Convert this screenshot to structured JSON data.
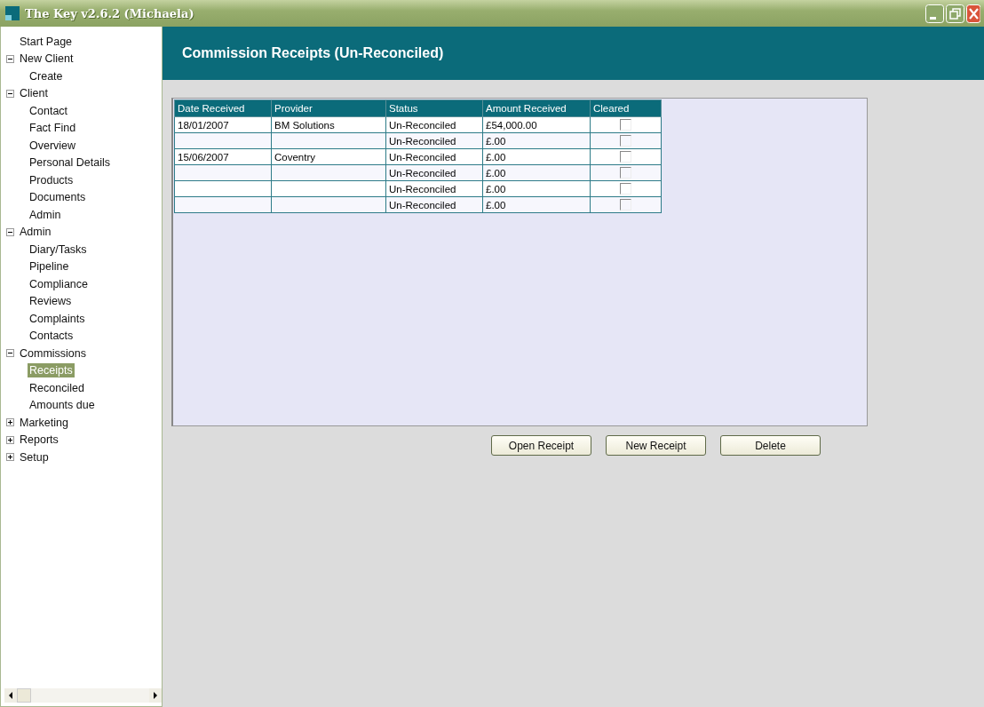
{
  "window": {
    "title": "The Key v2.6.2 (Michaela)"
  },
  "sidebar": {
    "items": [
      {
        "label": "Start Page",
        "selected": false
      },
      {
        "label": "New Client",
        "selected": false,
        "expanded": true,
        "children": [
          {
            "label": "Create",
            "selected": false
          }
        ]
      },
      {
        "label": "Client",
        "selected": false,
        "expanded": true,
        "children": [
          {
            "label": "Contact",
            "selected": false
          },
          {
            "label": "Fact Find",
            "selected": false
          },
          {
            "label": "Overview",
            "selected": false
          },
          {
            "label": "Personal Details",
            "selected": false
          },
          {
            "label": "Products",
            "selected": false
          },
          {
            "label": "Documents",
            "selected": false
          },
          {
            "label": "Admin",
            "selected": false
          }
        ]
      },
      {
        "label": "Admin",
        "selected": false,
        "expanded": true,
        "children": [
          {
            "label": "Diary/Tasks",
            "selected": false
          },
          {
            "label": "Pipeline",
            "selected": false
          },
          {
            "label": "Compliance",
            "selected": false
          },
          {
            "label": "Reviews",
            "selected": false
          },
          {
            "label": "Complaints",
            "selected": false
          },
          {
            "label": "Contacts",
            "selected": false
          }
        ]
      },
      {
        "label": "Commissions",
        "selected": false,
        "expanded": true,
        "children": [
          {
            "label": "Receipts",
            "selected": true
          },
          {
            "label": "Reconciled",
            "selected": false
          },
          {
            "label": "Amounts due",
            "selected": false
          }
        ]
      },
      {
        "label": "Marketing",
        "selected": false,
        "expanded": false
      },
      {
        "label": "Reports",
        "selected": false,
        "expanded": false
      },
      {
        "label": "Setup",
        "selected": false,
        "expanded": false
      }
    ]
  },
  "header": {
    "title": "Commission Receipts (Un-Reconciled)"
  },
  "table": {
    "columns": [
      "Date Received",
      "Provider",
      "Status",
      "Amount Received",
      "Cleared"
    ],
    "rows": [
      {
        "date_received": "18/01/2007",
        "provider": "BM Solutions",
        "status": "Un-Reconciled",
        "amount_received": "£54,000.00",
        "cleared": false
      },
      {
        "status": "Un-Reconciled",
        "amount_received": "£.00",
        "cleared": false
      },
      {
        "date_received": "15/06/2007",
        "provider": "Coventry",
        "status": "Un-Reconciled",
        "amount_received": "£.00",
        "cleared": false
      },
      {
        "status": "Un-Reconciled",
        "amount_received": "£.00",
        "cleared": false
      },
      {
        "status": "Un-Reconciled",
        "amount_received": "£.00",
        "cleared": false
      },
      {
        "status": "Un-Reconciled",
        "amount_received": "£.00",
        "cleared": false
      }
    ]
  },
  "buttons": [
    "Open Receipt",
    "New Receipt",
    "Delete"
  ]
}
